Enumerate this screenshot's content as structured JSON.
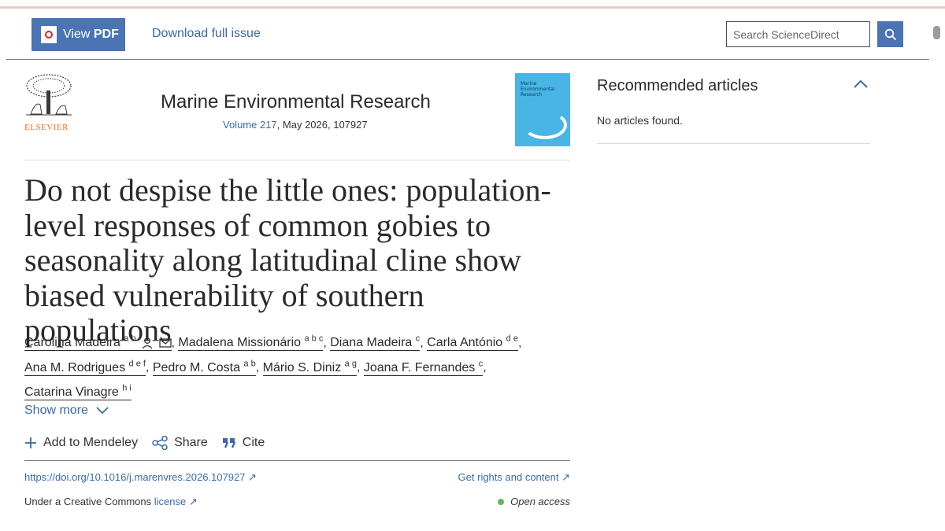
{
  "header": {
    "view_pdf_prefix": "View",
    "view_pdf_bold": "PDF",
    "download_label": "Download full issue",
    "search_placeholder": "Search ScienceDirect"
  },
  "journal": {
    "publisher": "ELSEVIER",
    "title": "Marine Environmental Research",
    "volume_link": "Volume 217",
    "issue_rest": ", May 2026, 107927",
    "cover_text": "Marine Environmental Research"
  },
  "article": {
    "title": "Do not despise the little ones: population-level responses of common gobies to seasonality along latitudinal cline show biased vulnerability of southern populations",
    "authors": [
      {
        "name": "Carolina Madeira",
        "sup": "a b"
      },
      {
        "name": "Madalena Missionário",
        "sup": "a b c"
      },
      {
        "name": "Diana Madeira",
        "sup": "c"
      },
      {
        "name": "Carla António",
        "sup": "d e"
      },
      {
        "name": "Ana M. Rodrigues",
        "sup": "d e f"
      },
      {
        "name": "Pedro M. Costa",
        "sup": "a b"
      },
      {
        "name": "Mário S. Diniz",
        "sup": "a g"
      },
      {
        "name": "Joana F. Fernandes",
        "sup": "c"
      },
      {
        "name": "Catarina Vinagre",
        "sup": "h i"
      }
    ],
    "show_more": "Show more",
    "actions": {
      "mendeley": "Add to Mendeley",
      "share": "Share",
      "cite": "Cite"
    },
    "doi": "https://doi.org/10.1016/j.marenvres.2026.107927",
    "rights": "Get rights and content",
    "license_prefix": "Under a Creative Commons",
    "license_link": "license",
    "open_access": "Open access"
  },
  "recommended": {
    "title": "Recommended articles",
    "empty": "No articles found."
  },
  "colors": {
    "brand_blue": "#4a74b3",
    "link": "#3b6aa6",
    "open_access_dot": "#5fb760",
    "elsevier_orange": "#e9711c"
  }
}
